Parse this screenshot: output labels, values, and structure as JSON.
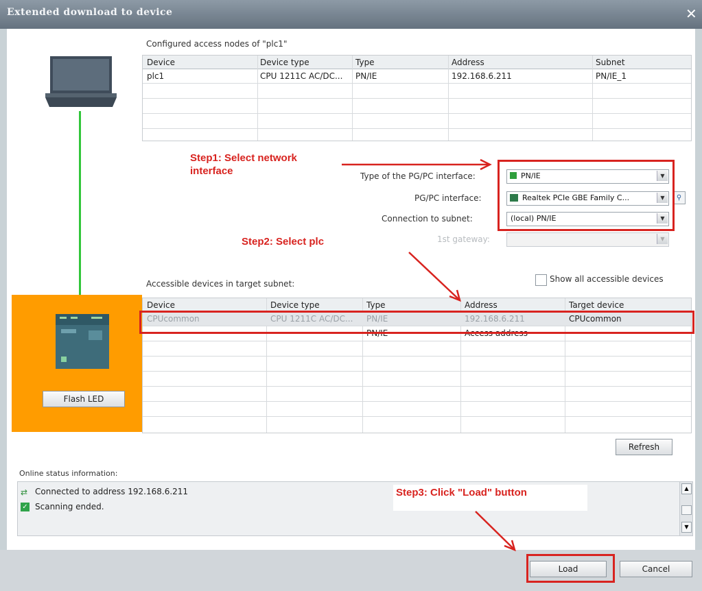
{
  "window": {
    "title": "Extended download to device"
  },
  "configured": {
    "heading": "Configured access nodes of \"plc1\"",
    "columns": [
      "Device",
      "Device type",
      "Type",
      "Address",
      "Subnet"
    ],
    "rows": [
      [
        "plc1",
        "CPU 1211C AC/DC...",
        "PN/IE",
        "192.168.6.211",
        "PN/IE_1"
      ]
    ]
  },
  "interface": {
    "type_label": "Type of the PG/PC interface:",
    "type_value": "PN/IE",
    "pgpc_label": "PG/PC interface:",
    "pgpc_value": "Realtek PCIe GBE Family C...",
    "subnet_label": "Connection to subnet:",
    "subnet_value": "(local) PN/IE",
    "gateway_label": "1st gateway:",
    "gateway_value": ""
  },
  "accessible": {
    "heading": "Accessible devices in target subnet:",
    "show_all_label": "Show all accessible devices",
    "columns": [
      "Device",
      "Device type",
      "Type",
      "Address",
      "Target device"
    ],
    "rows": [
      [
        "CPUcommon",
        "CPU 1211C AC/DC...",
        "PN/IE",
        "192.168.6.211",
        "CPUcommon"
      ],
      [
        "—",
        "—",
        "PN/IE",
        "Access address",
        "—"
      ]
    ]
  },
  "flash_led_label": "Flash LED",
  "refresh_label": "Refresh",
  "status": {
    "heading": "Online status information:",
    "lines": [
      "Connected to address 192.168.6.211",
      "Scanning ended."
    ]
  },
  "buttons": {
    "load": "Load",
    "cancel": "Cancel"
  },
  "annotations": {
    "step1": "Step1: Select network interface",
    "step2": "Step2: Select plc",
    "step3": "Step3: Click \"Load\" button"
  },
  "colors": {
    "annotation_red": "#d8231f",
    "device_panel_orange": "#ff9c00",
    "link_green": "#31c63a"
  }
}
